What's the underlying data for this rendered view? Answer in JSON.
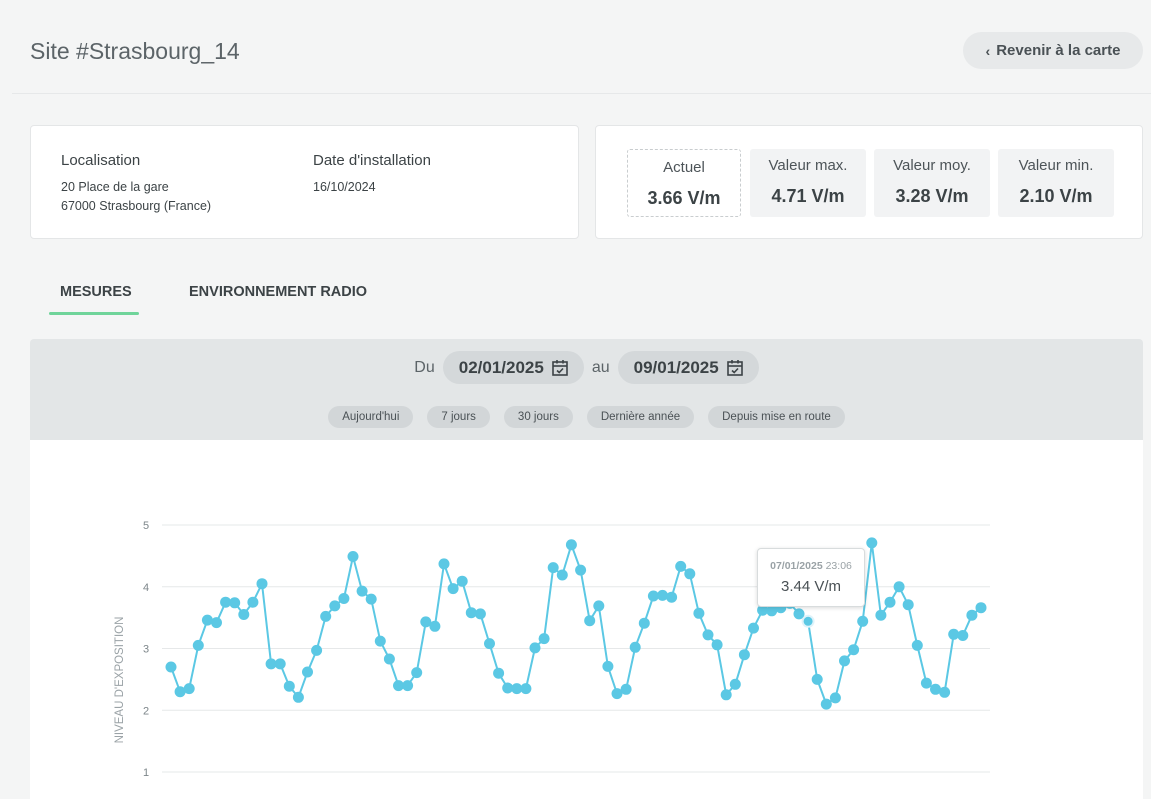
{
  "header": {
    "title": "Site #Strasbourg_14",
    "back_label": "Revenir à la carte"
  },
  "info": {
    "location_label": "Localisation",
    "address_line1": "20 Place de la gare",
    "address_line2": "67000 Strasbourg (France)",
    "install_label": "Date d'installation",
    "install_date": "16/10/2024"
  },
  "stats": [
    {
      "label": "Actuel",
      "value": "3.66 V/m"
    },
    {
      "label": "Valeur max.",
      "value": "4.71 V/m"
    },
    {
      "label": "Valeur moy.",
      "value": "3.28 V/m"
    },
    {
      "label": "Valeur min.",
      "value": "2.10 V/m"
    }
  ],
  "tabs": [
    {
      "label": "MESURES",
      "active": true
    },
    {
      "label": "ENVIRONNEMENT RADIO",
      "active": false
    }
  ],
  "filters": {
    "from_word": "Du",
    "from_date": "02/01/2025",
    "to_word": "au",
    "to_date": "09/01/2025",
    "presets": [
      "Aujourd'hui",
      "7 jours",
      "30 jours",
      "Dernière année",
      "Depuis mise en route"
    ]
  },
  "colors": {
    "accent": "#6fd49a",
    "series": "#5bc8e4",
    "grid": "#e6e8e9"
  },
  "tooltip": {
    "date": "07/01/2025",
    "time": "23:06",
    "value": "3.44 V/m"
  },
  "chart_data": {
    "type": "line",
    "ylabel": "NIVEAU D'EXPOSITION",
    "ylim": [
      1,
      5
    ],
    "yticks": [
      "1",
      "2",
      "3",
      "4",
      "5"
    ],
    "grid": true,
    "series": [
      {
        "values": [
          2.7,
          2.3,
          2.35,
          3.05,
          3.46,
          3.42,
          3.75,
          3.74,
          3.55,
          3.75,
          4.05,
          2.75,
          2.75,
          2.39,
          2.21,
          2.62,
          2.97,
          3.52,
          3.69,
          3.81,
          4.49,
          3.93,
          3.8,
          3.12,
          2.83,
          2.4,
          2.4,
          2.61,
          3.43,
          3.36,
          4.37,
          3.97,
          4.09,
          3.58,
          3.56,
          3.08,
          2.6,
          2.36,
          2.35,
          2.35,
          3.01,
          3.16,
          4.31,
          4.19,
          4.68,
          4.27,
          3.45,
          3.69,
          2.71,
          2.27,
          2.34,
          3.02,
          3.41,
          3.85,
          3.86,
          3.83,
          4.33,
          4.21,
          3.57,
          3.22,
          3.06,
          2.25,
          2.42,
          2.9,
          3.33,
          3.62,
          3.61,
          3.66,
          3.73,
          3.56,
          3.44,
          2.5,
          2.1,
          2.2,
          2.8,
          2.98,
          3.44,
          4.71,
          3.54,
          3.75,
          4.0,
          3.71,
          3.05,
          2.44,
          2.34,
          2.29,
          3.23,
          3.21,
          3.54,
          3.66
        ]
      }
    ]
  }
}
